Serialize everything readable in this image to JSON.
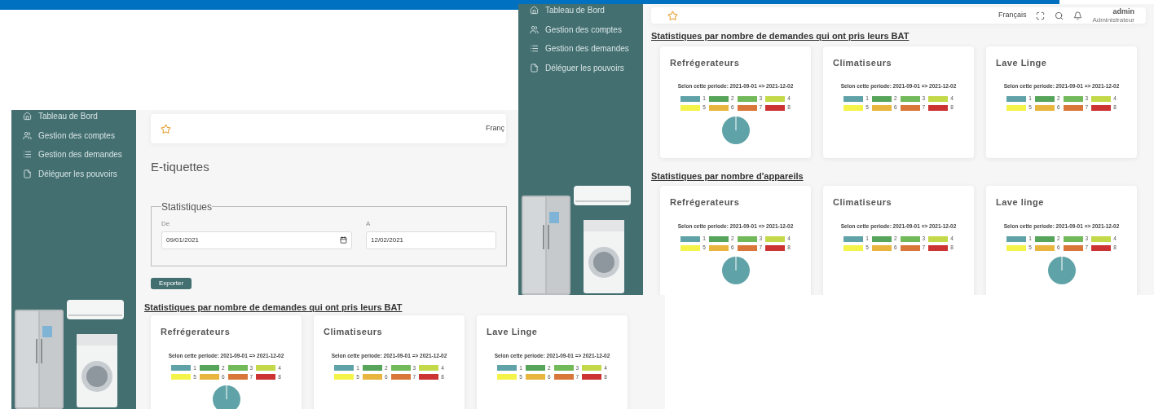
{
  "screenshots": [
    {
      "kind": "form_view",
      "sidebar": {
        "items": [
          "Tableau de Bord",
          "Gestion des comptes",
          "Gestion des demandes",
          "Déléguer les pouvoirs"
        ]
      },
      "header": {
        "language": "Franç"
      },
      "page_title": "E-tiquettes",
      "filter": {
        "legend": "Statistiques",
        "fields": [
          {
            "label": "De",
            "value": "09/01/2021"
          },
          {
            "label": "A",
            "value": "12/02/2021"
          }
        ],
        "button": "Exporter"
      },
      "sections": [
        {
          "title": "Statistiques par nombre de demandes qui ont pris leurs BAT",
          "cards": [
            {
              "title": "Refrégerateurs",
              "period": "Selon cette periode: 2021-09-01 => 2021-12-02",
              "pie": true,
              "legend": [
                {
                  "label": "1",
                  "color": "#5fa3a8"
                },
                {
                  "label": "2",
                  "color": "#57a55a"
                },
                {
                  "label": "3",
                  "color": "#72b95a"
                },
                {
                  "label": "4",
                  "color": "#c3d94a"
                },
                {
                  "label": "5",
                  "color": "#f4f34a"
                },
                {
                  "label": "6",
                  "color": "#e8b63f"
                },
                {
                  "label": "7",
                  "color": "#d9773a"
                },
                {
                  "label": "8",
                  "color": "#cc3333"
                }
              ]
            },
            {
              "title": "Climatiseurs",
              "period": "Selon cette periode: 2021-09-01 => 2021-12-02",
              "pie": false,
              "legend": [
                {
                  "label": "1",
                  "color": "#5fa3a8"
                },
                {
                  "label": "2",
                  "color": "#57a55a"
                },
                {
                  "label": "3",
                  "color": "#72b95a"
                },
                {
                  "label": "4",
                  "color": "#c3d94a"
                },
                {
                  "label": "5",
                  "color": "#f4f34a"
                },
                {
                  "label": "6",
                  "color": "#e8b63f"
                },
                {
                  "label": "7",
                  "color": "#d9773a"
                },
                {
                  "label": "8",
                  "color": "#cc3333"
                }
              ]
            },
            {
              "title": "Lave Linge",
              "period": "Selon cette periode: 2021-09-01 => 2021-12-02",
              "pie": false,
              "legend": [
                {
                  "label": "1",
                  "color": "#5fa3a8"
                },
                {
                  "label": "2",
                  "color": "#57a55a"
                },
                {
                  "label": "3",
                  "color": "#72b95a"
                },
                {
                  "label": "4",
                  "color": "#c3d94a"
                },
                {
                  "label": "5",
                  "color": "#f4f34a"
                },
                {
                  "label": "6",
                  "color": "#e8b63f"
                },
                {
                  "label": "7",
                  "color": "#d9773a"
                },
                {
                  "label": "8",
                  "color": "#cc3333"
                }
              ]
            }
          ]
        }
      ]
    },
    {
      "kind": "dashboard_view",
      "sidebar": {
        "items": [
          "Tableau de Bord",
          "Gestion des comptes",
          "Gestion des demandes",
          "Déléguer les pouvoirs"
        ]
      },
      "header": {
        "language": "Français",
        "user": {
          "name": "admin",
          "role": "Administrateur"
        }
      },
      "sections": [
        {
          "title": "Statistiques par nombre de demandes qui ont pris leurs BAT",
          "cards": [
            {
              "title": "Refrégerateurs",
              "period": "Selon cette periode: 2021-09-01 => 2021-12-02",
              "pie": true,
              "legend": [
                {
                  "label": "1",
                  "color": "#5fa3a8"
                },
                {
                  "label": "2",
                  "color": "#57a55a"
                },
                {
                  "label": "3",
                  "color": "#72b95a"
                },
                {
                  "label": "4",
                  "color": "#c3d94a"
                },
                {
                  "label": "5",
                  "color": "#f4f34a"
                },
                {
                  "label": "6",
                  "color": "#e8b63f"
                },
                {
                  "label": "7",
                  "color": "#d9773a"
                },
                {
                  "label": "8",
                  "color": "#cc3333"
                }
              ]
            },
            {
              "title": "Climatiseurs",
              "period": "Selon cette periode: 2021-09-01 => 2021-12-02",
              "pie": false,
              "legend": [
                {
                  "label": "1",
                  "color": "#5fa3a8"
                },
                {
                  "label": "2",
                  "color": "#57a55a"
                },
                {
                  "label": "3",
                  "color": "#72b95a"
                },
                {
                  "label": "4",
                  "color": "#c3d94a"
                },
                {
                  "label": "5",
                  "color": "#f4f34a"
                },
                {
                  "label": "6",
                  "color": "#e8b63f"
                },
                {
                  "label": "7",
                  "color": "#d9773a"
                },
                {
                  "label": "8",
                  "color": "#cc3333"
                }
              ]
            },
            {
              "title": "Lave Linge",
              "period": "Selon cette periode: 2021-09-01 => 2021-12-02",
              "pie": false,
              "legend": [
                {
                  "label": "1",
                  "color": "#5fa3a8"
                },
                {
                  "label": "2",
                  "color": "#57a55a"
                },
                {
                  "label": "3",
                  "color": "#72b95a"
                },
                {
                  "label": "4",
                  "color": "#c3d94a"
                },
                {
                  "label": "5",
                  "color": "#f4f34a"
                },
                {
                  "label": "6",
                  "color": "#e8b63f"
                },
                {
                  "label": "7",
                  "color": "#d9773a"
                },
                {
                  "label": "8",
                  "color": "#cc3333"
                }
              ]
            }
          ]
        },
        {
          "title": "Statistiques par nombre d'appareils",
          "cards": [
            {
              "title": "Refrégerateurs",
              "period": "Selon cette periode: 2021-09-01 => 2021-12-02",
              "pie": true,
              "legend": [
                {
                  "label": "1",
                  "color": "#5fa3a8"
                },
                {
                  "label": "2",
                  "color": "#57a55a"
                },
                {
                  "label": "3",
                  "color": "#72b95a"
                },
                {
                  "label": "4",
                  "color": "#c3d94a"
                },
                {
                  "label": "5",
                  "color": "#f4f34a"
                },
                {
                  "label": "6",
                  "color": "#e8b63f"
                },
                {
                  "label": "7",
                  "color": "#d9773a"
                },
                {
                  "label": "8",
                  "color": "#cc3333"
                }
              ]
            },
            {
              "title": "Climatiseurs",
              "period": "Selon cette periode: 2021-09-01 => 2021-12-02",
              "pie": false,
              "legend": [
                {
                  "label": "1",
                  "color": "#5fa3a8"
                },
                {
                  "label": "2",
                  "color": "#57a55a"
                },
                {
                  "label": "3",
                  "color": "#72b95a"
                },
                {
                  "label": "4",
                  "color": "#c3d94a"
                },
                {
                  "label": "5",
                  "color": "#f4f34a"
                },
                {
                  "label": "6",
                  "color": "#e8b63f"
                },
                {
                  "label": "7",
                  "color": "#d9773a"
                },
                {
                  "label": "8",
                  "color": "#cc3333"
                }
              ]
            },
            {
              "title": "Lave linge",
              "period": "Selon cette periode: 2021-09-01 => 2021-12-02",
              "pie": true,
              "legend": [
                {
                  "label": "1",
                  "color": "#5fa3a8"
                },
                {
                  "label": "2",
                  "color": "#57a55a"
                },
                {
                  "label": "3",
                  "color": "#72b95a"
                },
                {
                  "label": "4",
                  "color": "#c3d94a"
                },
                {
                  "label": "5",
                  "color": "#f4f34a"
                },
                {
                  "label": "6",
                  "color": "#e8b63f"
                },
                {
                  "label": "7",
                  "color": "#d9773a"
                },
                {
                  "label": "8",
                  "color": "#cc3333"
                }
              ]
            }
          ]
        }
      ]
    }
  ]
}
